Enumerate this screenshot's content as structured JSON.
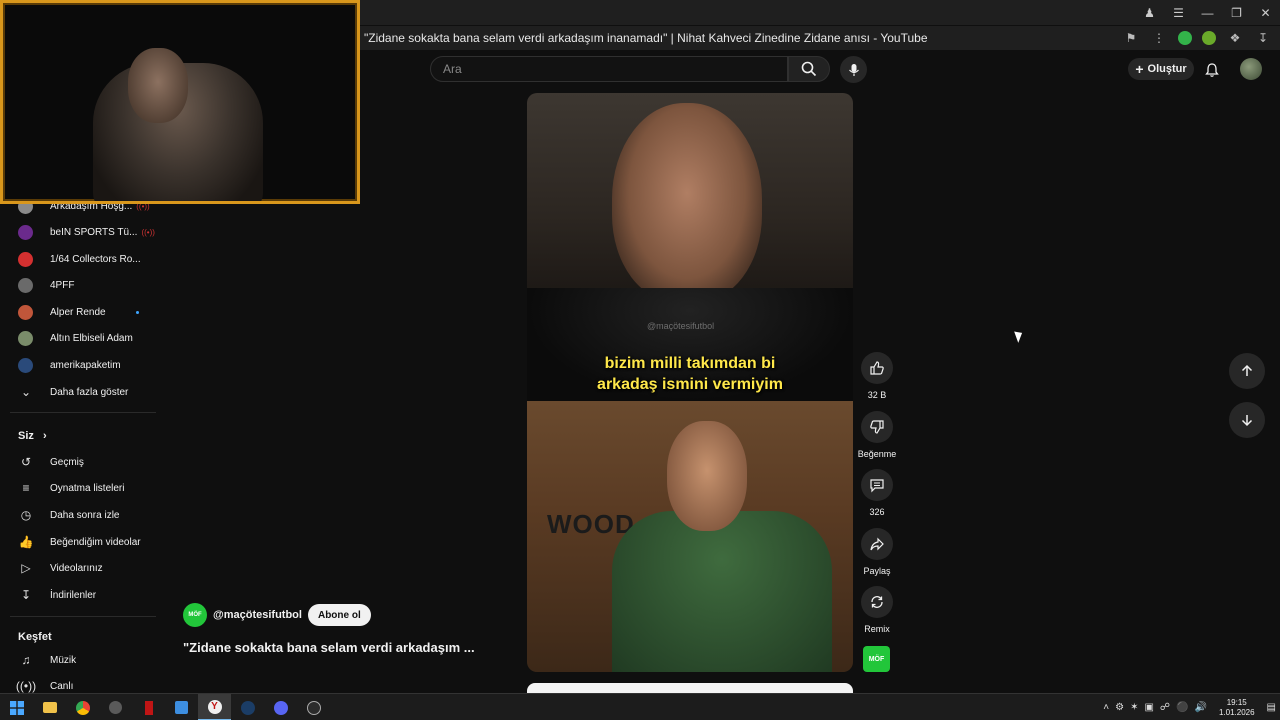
{
  "browser": {
    "tab_title": "\"Zidane sokakta bana selam verdi arkadaşım inanamadı\" | Nihat Kahveci Zinedine Zidane anısı - YouTube"
  },
  "header": {
    "search_placeholder": "Ara",
    "create_label": "Oluştur"
  },
  "sidebar": {
    "subscriptions": [
      {
        "label": "Arkadaşım Hoşg...",
        "live": true,
        "color": "#8a8a8a"
      },
      {
        "label": "beIN SPORTS Tü...",
        "live": true,
        "color": "#6b2a8c"
      },
      {
        "label": "1/64 Collectors Ro...",
        "live": false,
        "color": "#d43030"
      },
      {
        "label": "4PFF",
        "live": false,
        "color": "#6a6a6a"
      },
      {
        "label": "Alper Rende",
        "live": false,
        "new_dot": true,
        "color": "#c0563a"
      },
      {
        "label": "Altın Elbiseli Adam",
        "live": false,
        "color": "#7a8c6a"
      },
      {
        "label": "amerikapaketim",
        "live": false,
        "color": "#2a4a7a"
      }
    ],
    "show_more": "Daha fazla göster",
    "you_heading": "Siz",
    "you_items": [
      {
        "label": "Geçmiş",
        "icon": "history-icon"
      },
      {
        "label": "Oynatma listeleri",
        "icon": "playlist-icon"
      },
      {
        "label": "Daha sonra izle",
        "icon": "clock-icon"
      },
      {
        "label": "Beğendiğim videolar",
        "icon": "thumb-up-icon"
      },
      {
        "label": "Videolarınız",
        "icon": "video-icon"
      },
      {
        "label": "İndirilenler",
        "icon": "download-icon"
      }
    ],
    "explore_heading": "Keşfet",
    "explore_items": [
      {
        "label": "Müzik",
        "icon": "music-icon"
      },
      {
        "label": "Canlı",
        "icon": "live-icon"
      }
    ]
  },
  "short": {
    "subtitle_line1": "bizim milli takımdan bi",
    "subtitle_line2": "arkadaş ismini vermiyim",
    "watermark": "@maçötesifutbol",
    "sign_text": "WOOD",
    "channel_handle": "@maçötesifutbol",
    "channel_avatar_text": "MÖF",
    "subscribe_label": "Abone ol",
    "title": "\"Zidane sokakta bana selam verdi arkadaşım ..."
  },
  "actions": {
    "like_count": "32 B",
    "dislike_label": "Beğenme",
    "comment_count": "326",
    "share_label": "Paylaş",
    "remix_label": "Remix",
    "channel_logo_text": "MÖF"
  },
  "taskbar": {
    "time": "19:15",
    "date": "1.01.2026"
  }
}
